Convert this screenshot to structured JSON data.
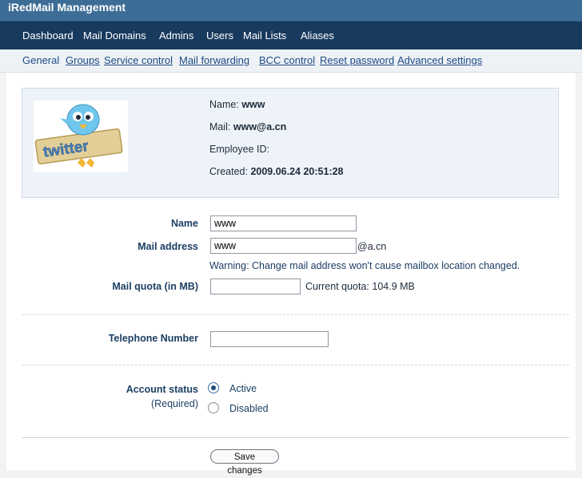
{
  "app": {
    "title": "iRedMail Management"
  },
  "main_nav": [
    {
      "label": "Dashboard"
    },
    {
      "label": "Mail Domains"
    },
    {
      "label": "Admins"
    },
    {
      "label": "Users"
    },
    {
      "label": "Mail Lists"
    },
    {
      "label": "Aliases"
    }
  ],
  "sub_nav": [
    {
      "label": "General"
    },
    {
      "label": "Groups"
    },
    {
      "label": "Service control"
    },
    {
      "label": "Mail forwarding"
    },
    {
      "label": "BCC control"
    },
    {
      "label": "Reset password"
    },
    {
      "label": "Advanced settings"
    }
  ],
  "profile": {
    "avatar_text": "twitter",
    "name_label": "Name:",
    "name_value": "www",
    "mail_label": "Mail:",
    "mail_value": "www@a.cn",
    "employee_label": "Employee ID:",
    "employee_value": "",
    "created_label": "Created:",
    "created_value": "2009.06.24 20:51:28"
  },
  "form": {
    "name_label": "Name",
    "name_value": "www",
    "mail_label": "Mail address",
    "mail_value": "www",
    "mail_domain": "@a.cn",
    "mail_warning": "Warning: Change mail address won't cause mailbox location changed.",
    "quota_label": "Mail quota (in MB)",
    "quota_value": "",
    "current_quota": "Current quota: 104.9 MB",
    "phone_label": "Telephone Number",
    "phone_value": "",
    "status_label": "Account status",
    "status_required": "(Required)",
    "status_options": [
      {
        "label": "Active",
        "selected": true
      },
      {
        "label": "Disabled",
        "selected": false
      }
    ],
    "save_label": "Save changes"
  }
}
